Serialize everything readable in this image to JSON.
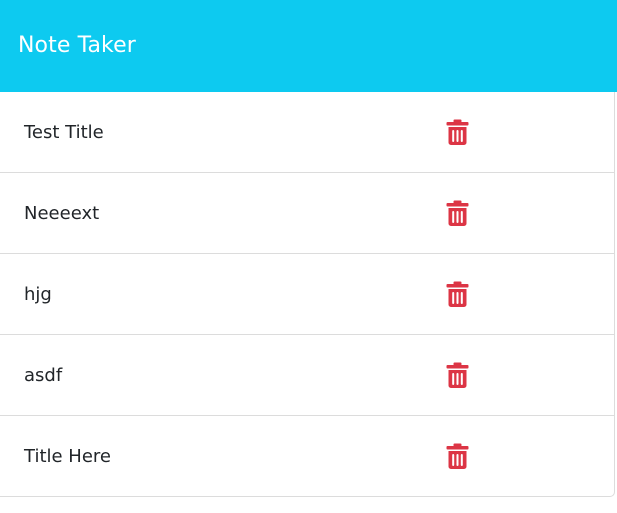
{
  "app": {
    "title": "Note Taker"
  },
  "colors": {
    "navbar": "#0dcaf0",
    "delete": "#dc3545"
  },
  "notes": [
    {
      "title": "Test Title"
    },
    {
      "title": "Neeeext"
    },
    {
      "title": "hjg"
    },
    {
      "title": "asdf"
    },
    {
      "title": "Title Here"
    }
  ],
  "icons": {
    "delete": "trash-icon"
  }
}
